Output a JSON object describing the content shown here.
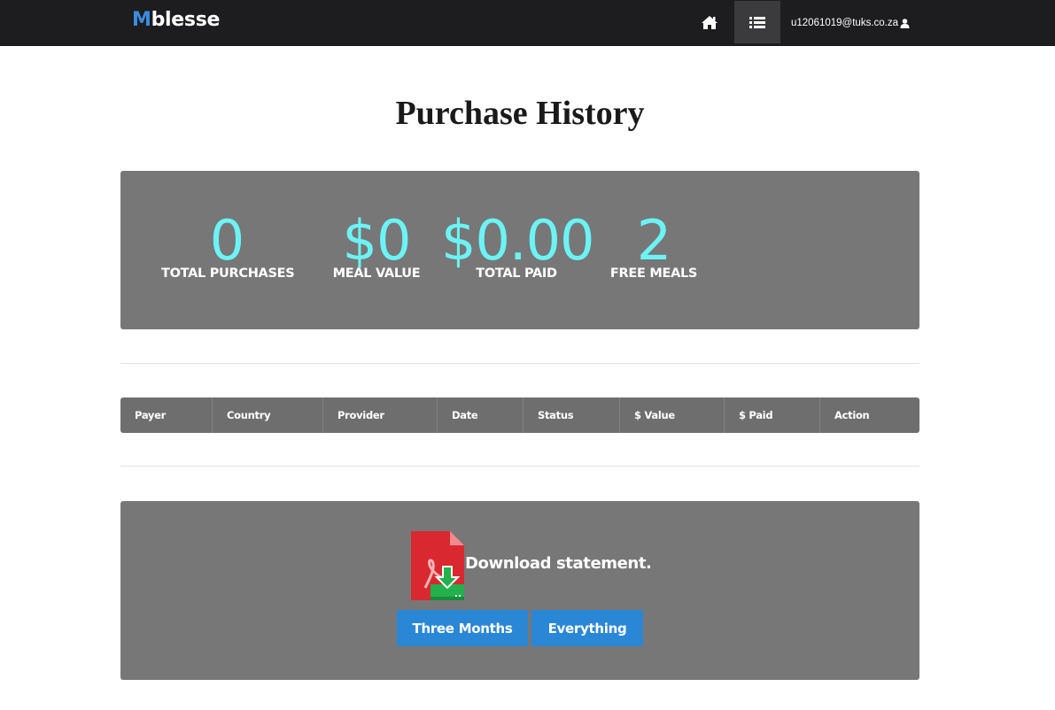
{
  "navbar": {
    "brand_first": "M",
    "brand_rest": "blesse",
    "home_icon": "home-icon",
    "menu_icon": "list-icon",
    "user_email": "u12061019@tuks.co.za",
    "user_icon": "user-icon"
  },
  "page": {
    "title": "Purchase History"
  },
  "stats": [
    {
      "value": "0",
      "label": "TOTAL PURCHASES"
    },
    {
      "value": "$0",
      "label": "MEAL VALUE"
    },
    {
      "value": "$0.00",
      "label": "TOTAL PAID"
    },
    {
      "value": "2",
      "label": "FREE MEALS"
    }
  ],
  "table": {
    "columns": [
      "Payer",
      "Country",
      "Provider",
      "Date",
      "Status",
      "$ Value",
      "$ Paid",
      "Action"
    ],
    "rows": []
  },
  "download": {
    "icon": "pdf-download-icon",
    "text": "Download statement.",
    "three_months_label": "Three Months",
    "everything_label": "Everything"
  },
  "colors": {
    "navbar_bg": "#1d1d1f",
    "brand_accent": "#3b8de0",
    "panel_bg": "#777777",
    "stat_value": "#6cf3f5",
    "button_bg": "#2a87d6",
    "pdf_red": "#d9282f",
    "download_green": "#22b14c"
  }
}
